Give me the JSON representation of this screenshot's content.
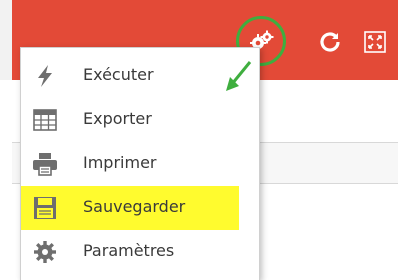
{
  "toolbar": {
    "gear_icon": "gear-icon",
    "refresh_icon": "refresh-icon",
    "fullscreen_icon": "fullscreen-icon",
    "accent_color": "#e34a37"
  },
  "annotation": {
    "ring_color": "#3fae3f",
    "highlight_color": "#fffb2e"
  },
  "menu": {
    "items": [
      {
        "label": "Exécuter",
        "icon": "lightning-icon"
      },
      {
        "label": "Exporter",
        "icon": "table-grid-icon"
      },
      {
        "label": "Imprimer",
        "icon": "printer-icon"
      },
      {
        "label": "Sauvegarder",
        "icon": "save-disk-icon",
        "highlighted": true
      },
      {
        "label": "Paramètres",
        "icon": "settings-gear-icon"
      }
    ]
  }
}
